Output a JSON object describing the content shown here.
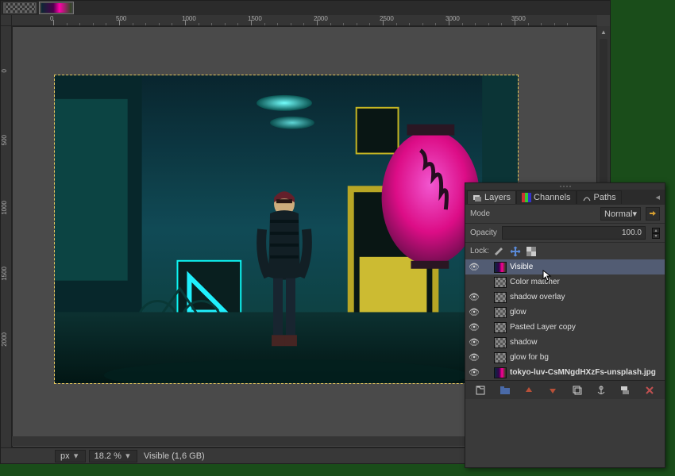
{
  "statusbar": {
    "unit": "px",
    "zoom": "18.2 %",
    "info": "Visible (1,6 GB)"
  },
  "panel": {
    "tabs": {
      "layers": "Layers",
      "channels": "Channels",
      "paths": "Paths"
    },
    "mode_label": "Mode",
    "mode_value": "Normal",
    "opacity_label": "Opacity",
    "opacity_value": "100.0",
    "lock_label": "Lock:"
  },
  "layers": [
    {
      "name": "Visible",
      "visible": true,
      "selected": true,
      "thumb": "img",
      "bold": false
    },
    {
      "name": "Color matcher",
      "visible": false,
      "selected": false,
      "thumb": "checker",
      "bold": false
    },
    {
      "name": "shadow overlay",
      "visible": true,
      "selected": false,
      "thumb": "checker",
      "bold": false
    },
    {
      "name": "glow",
      "visible": true,
      "selected": false,
      "thumb": "checker",
      "bold": false
    },
    {
      "name": "Pasted Layer copy",
      "visible": true,
      "selected": false,
      "thumb": "checker",
      "bold": false
    },
    {
      "name": "shadow",
      "visible": true,
      "selected": false,
      "thumb": "checker",
      "bold": false
    },
    {
      "name": "glow for bg",
      "visible": true,
      "selected": false,
      "thumb": "checker",
      "bold": false
    },
    {
      "name": "tokyo-luv-CsMNgdHXzFs-unsplash.jpg",
      "visible": true,
      "selected": false,
      "thumb": "img",
      "bold": true
    }
  ],
  "ruler": {
    "h_marks": [
      "0",
      "500",
      "1000",
      "1500",
      "2000",
      "2500",
      "3000",
      "3500"
    ],
    "v_marks": [
      "0",
      "500",
      "1000",
      "1500",
      "2000"
    ]
  }
}
